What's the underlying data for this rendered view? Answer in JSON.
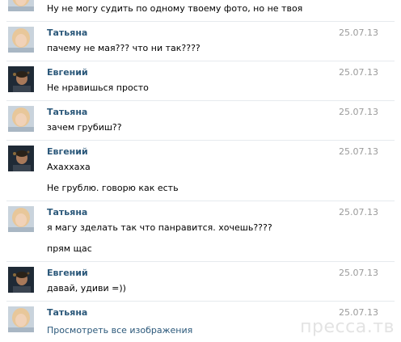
{
  "messages": [
    {
      "sender": "",
      "date": "",
      "text": "Ну не могу судить по одному твоему фото, но не твоя",
      "avatar": "female-avatar"
    },
    {
      "sender": "Татьяна",
      "date": "25.07.13",
      "text": "пачему не мая??? что ни так????",
      "avatar": "female-avatar"
    },
    {
      "sender": "Евгений",
      "date": "25.07.13",
      "text": "Не нравишься просто",
      "avatar": "male-avatar"
    },
    {
      "sender": "Татьяна",
      "date": "25.07.13",
      "text": "зачем грубиш??",
      "avatar": "female-avatar"
    },
    {
      "sender": "Евгений",
      "date": "25.07.13",
      "text": "Ахаххаха",
      "text2": "Не грублю. говорю как есть",
      "avatar": "male-avatar"
    },
    {
      "sender": "Татьяна",
      "date": "25.07.13",
      "text": "я магу зделать так что панравится. хочешь????",
      "text2": "прям щас",
      "avatar": "female-avatar"
    },
    {
      "sender": "Евгений",
      "date": "25.07.13",
      "text": "давай, удиви =))",
      "avatar": "male-avatar"
    },
    {
      "sender": "Татьяна",
      "date": "25.07.13",
      "link": "Просмотреть все изображения",
      "avatar": "female-avatar"
    }
  ],
  "watermark": "пресса.тв",
  "colors": {
    "name": "#2b587a",
    "date": "#9a9a9a",
    "divider": "#e6eaee"
  }
}
